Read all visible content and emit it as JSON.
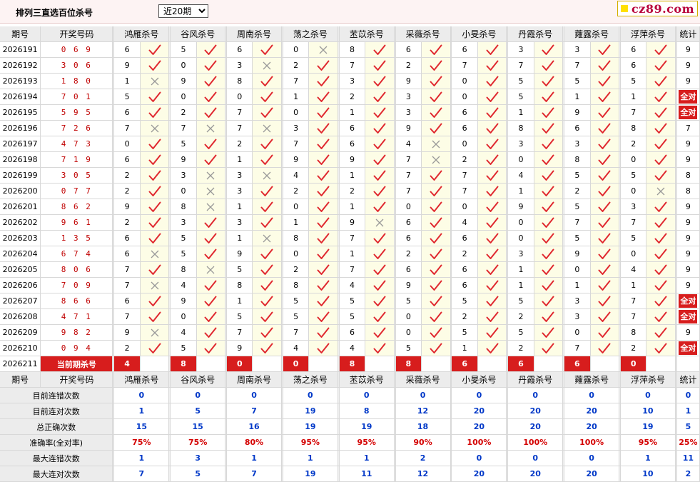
{
  "header": {
    "title": "排列三直选百位杀号",
    "period_select": "近20期",
    "logo_text": "cz89.com"
  },
  "columns": {
    "issue": "期号",
    "number": "开奖号码",
    "experts": [
      "鸿雁杀号",
      "谷风杀号",
      "周南杀号",
      "荡之杀号",
      "苤苡杀号",
      "采薇杀号",
      "小旻杀号",
      "丹霞杀号",
      "蕹露杀号",
      "浮萍杀号"
    ],
    "stat": "统计"
  },
  "all_right_label": "全对",
  "rows": [
    {
      "issue": "2026191",
      "number": "0 6 9",
      "kills": [
        "6",
        "5",
        "6",
        "0",
        "8",
        "6",
        "6",
        "3",
        "3",
        "6"
      ],
      "marks": [
        "y",
        "y",
        "y",
        "n",
        "y",
        "y",
        "y",
        "y",
        "y",
        "y"
      ],
      "stat": "9"
    },
    {
      "issue": "2026192",
      "number": "3 0 6",
      "kills": [
        "9",
        "0",
        "3",
        "2",
        "7",
        "2",
        "7",
        "7",
        "7",
        "6"
      ],
      "marks": [
        "y",
        "y",
        "n",
        "y",
        "y",
        "y",
        "y",
        "y",
        "y",
        "y"
      ],
      "stat": "9"
    },
    {
      "issue": "2026193",
      "number": "1 8 0",
      "kills": [
        "1",
        "9",
        "8",
        "7",
        "3",
        "9",
        "0",
        "5",
        "5",
        "5"
      ],
      "marks": [
        "n",
        "y",
        "y",
        "y",
        "y",
        "y",
        "y",
        "y",
        "y",
        "y"
      ],
      "stat": "9"
    },
    {
      "issue": "2026194",
      "number": "7 0 1",
      "kills": [
        "5",
        "0",
        "0",
        "1",
        "2",
        "3",
        "0",
        "5",
        "1",
        "1"
      ],
      "marks": [
        "y",
        "y",
        "y",
        "y",
        "y",
        "y",
        "y",
        "y",
        "y",
        "y"
      ],
      "stat": "ALL"
    },
    {
      "issue": "2026195",
      "number": "5 9 5",
      "kills": [
        "6",
        "2",
        "7",
        "0",
        "1",
        "3",
        "6",
        "1",
        "9",
        "7"
      ],
      "marks": [
        "y",
        "y",
        "y",
        "y",
        "y",
        "y",
        "y",
        "y",
        "y",
        "y"
      ],
      "stat": "ALL"
    },
    {
      "issue": "2026196",
      "number": "7 2 6",
      "kills": [
        "7",
        "7",
        "7",
        "3",
        "6",
        "9",
        "6",
        "8",
        "6",
        "8"
      ],
      "marks": [
        "n",
        "n",
        "n",
        "y",
        "y",
        "y",
        "y",
        "y",
        "y",
        "y"
      ],
      "stat": "7"
    },
    {
      "issue": "2026197",
      "number": "4 7 3",
      "kills": [
        "0",
        "5",
        "2",
        "7",
        "6",
        "4",
        "0",
        "3",
        "3",
        "2"
      ],
      "marks": [
        "y",
        "y",
        "y",
        "y",
        "y",
        "n",
        "y",
        "y",
        "y",
        "y"
      ],
      "stat": "9"
    },
    {
      "issue": "2026198",
      "number": "7 1 9",
      "kills": [
        "6",
        "9",
        "1",
        "9",
        "9",
        "7",
        "2",
        "0",
        "8",
        "0"
      ],
      "marks": [
        "y",
        "y",
        "y",
        "y",
        "y",
        "n",
        "y",
        "y",
        "y",
        "y"
      ],
      "stat": "9"
    },
    {
      "issue": "2026199",
      "number": "3 0 5",
      "kills": [
        "2",
        "3",
        "3",
        "4",
        "1",
        "7",
        "7",
        "4",
        "5",
        "5"
      ],
      "marks": [
        "y",
        "n",
        "n",
        "y",
        "y",
        "y",
        "y",
        "y",
        "y",
        "y"
      ],
      "stat": "8"
    },
    {
      "issue": "2026200",
      "number": "0 7 7",
      "kills": [
        "2",
        "0",
        "3",
        "2",
        "2",
        "7",
        "7",
        "1",
        "2",
        "0"
      ],
      "marks": [
        "y",
        "n",
        "y",
        "y",
        "y",
        "y",
        "y",
        "y",
        "y",
        "n"
      ],
      "stat": "8"
    },
    {
      "issue": "2026201",
      "number": "8 6 2",
      "kills": [
        "9",
        "8",
        "1",
        "0",
        "1",
        "0",
        "0",
        "9",
        "5",
        "3"
      ],
      "marks": [
        "y",
        "n",
        "y",
        "y",
        "y",
        "y",
        "y",
        "y",
        "y",
        "y"
      ],
      "stat": "9"
    },
    {
      "issue": "2026202",
      "number": "9 6 1",
      "kills": [
        "2",
        "3",
        "3",
        "1",
        "9",
        "6",
        "4",
        "0",
        "7",
        "7"
      ],
      "marks": [
        "y",
        "y",
        "y",
        "y",
        "n",
        "y",
        "y",
        "y",
        "y",
        "y"
      ],
      "stat": "9"
    },
    {
      "issue": "2026203",
      "number": "1 3 5",
      "kills": [
        "6",
        "5",
        "1",
        "8",
        "7",
        "6",
        "6",
        "0",
        "5",
        "5"
      ],
      "marks": [
        "y",
        "y",
        "n",
        "y",
        "y",
        "y",
        "y",
        "y",
        "y",
        "y"
      ],
      "stat": "9"
    },
    {
      "issue": "2026204",
      "number": "6 7 4",
      "kills": [
        "6",
        "5",
        "9",
        "0",
        "1",
        "2",
        "2",
        "3",
        "9",
        "0"
      ],
      "marks": [
        "n",
        "y",
        "y",
        "y",
        "y",
        "y",
        "y",
        "y",
        "y",
        "y"
      ],
      "stat": "9"
    },
    {
      "issue": "2026205",
      "number": "8 0 6",
      "kills": [
        "7",
        "8",
        "5",
        "2",
        "7",
        "6",
        "6",
        "1",
        "0",
        "4"
      ],
      "marks": [
        "y",
        "n",
        "y",
        "y",
        "y",
        "y",
        "y",
        "y",
        "y",
        "y"
      ],
      "stat": "9"
    },
    {
      "issue": "2026206",
      "number": "7 0 9",
      "kills": [
        "7",
        "4",
        "8",
        "8",
        "4",
        "9",
        "6",
        "1",
        "1",
        "1"
      ],
      "marks": [
        "n",
        "y",
        "y",
        "y",
        "y",
        "y",
        "y",
        "y",
        "y",
        "y"
      ],
      "stat": "9"
    },
    {
      "issue": "2026207",
      "number": "8 6 6",
      "kills": [
        "6",
        "9",
        "1",
        "5",
        "5",
        "5",
        "5",
        "5",
        "3",
        "7"
      ],
      "marks": [
        "y",
        "y",
        "y",
        "y",
        "y",
        "y",
        "y",
        "y",
        "y",
        "y"
      ],
      "stat": "ALL"
    },
    {
      "issue": "2026208",
      "number": "4 7 1",
      "kills": [
        "7",
        "0",
        "5",
        "5",
        "5",
        "0",
        "2",
        "2",
        "3",
        "7"
      ],
      "marks": [
        "y",
        "y",
        "y",
        "y",
        "y",
        "y",
        "y",
        "y",
        "y",
        "y"
      ],
      "stat": "ALL"
    },
    {
      "issue": "2026209",
      "number": "9 8 2",
      "kills": [
        "9",
        "4",
        "7",
        "7",
        "6",
        "0",
        "5",
        "5",
        "0",
        "8"
      ],
      "marks": [
        "n",
        "y",
        "y",
        "y",
        "y",
        "y",
        "y",
        "y",
        "y",
        "y"
      ],
      "stat": "9"
    },
    {
      "issue": "2026210",
      "number": "0 9 4",
      "kills": [
        "2",
        "5",
        "9",
        "4",
        "4",
        "5",
        "1",
        "2",
        "7",
        "2"
      ],
      "marks": [
        "y",
        "y",
        "y",
        "y",
        "y",
        "y",
        "y",
        "y",
        "y",
        "y"
      ],
      "stat": "ALL"
    }
  ],
  "current": {
    "issue": "2026211",
    "label": "当前期杀号",
    "kills": [
      "4",
      "8",
      "0",
      "0",
      "8",
      "8",
      "6",
      "6",
      "6",
      "0"
    ]
  },
  "summary": [
    {
      "label": "目前连错次数",
      "values": [
        "0",
        "0",
        "0",
        "0",
        "0",
        "0",
        "0",
        "0",
        "0",
        "0"
      ],
      "stat": "0",
      "color": "blue"
    },
    {
      "label": "目前连对次数",
      "values": [
        "1",
        "5",
        "7",
        "19",
        "8",
        "12",
        "20",
        "20",
        "20",
        "10"
      ],
      "stat": "1",
      "color": "blue"
    },
    {
      "label": "总正确次数",
      "values": [
        "15",
        "15",
        "16",
        "19",
        "19",
        "18",
        "20",
        "20",
        "20",
        "19"
      ],
      "stat": "5",
      "color": "blue"
    },
    {
      "label": "准确率(全对率)",
      "values": [
        "75%",
        "75%",
        "80%",
        "95%",
        "95%",
        "90%",
        "100%",
        "100%",
        "100%",
        "95%"
      ],
      "stat": "25%",
      "color": "red"
    },
    {
      "label": "最大连错次数",
      "values": [
        "1",
        "3",
        "1",
        "1",
        "1",
        "2",
        "0",
        "0",
        "0",
        "1"
      ],
      "stat": "11",
      "color": "blue"
    },
    {
      "label": "最大连对次数",
      "values": [
        "7",
        "5",
        "7",
        "19",
        "11",
        "12",
        "20",
        "20",
        "20",
        "10"
      ],
      "stat": "2",
      "color": "blue"
    }
  ],
  "colors": {
    "accent_red": "#d71d1d",
    "mark_bg": "#fdfde6",
    "check": "#e0282f",
    "cross": "#999999",
    "blue": "#0038c8"
  }
}
